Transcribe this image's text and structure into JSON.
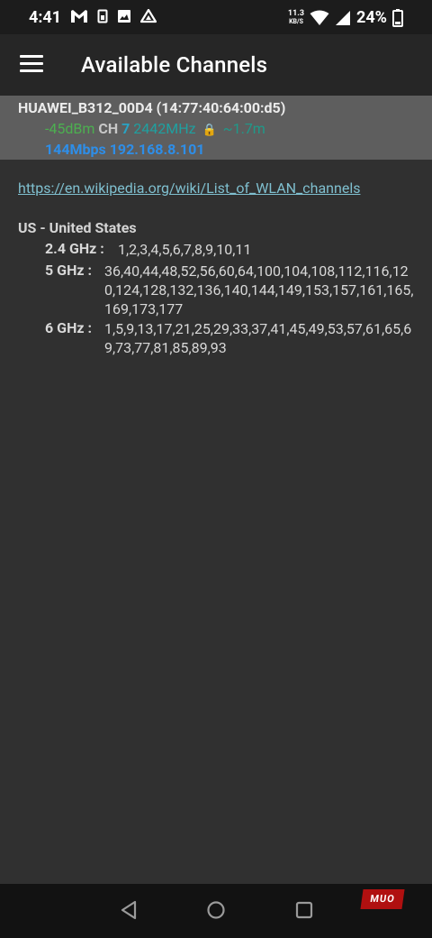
{
  "status_bar": {
    "time": "4:41",
    "left_icons": [
      "gmail-icon",
      "sim-icon",
      "gallery-icon",
      "drive-icon"
    ],
    "speed_value": "11.3",
    "speed_unit": "KB/S",
    "battery": "24%"
  },
  "app_bar": {
    "title": "Available Channels"
  },
  "network": {
    "name": "HUAWEI_B312_00D4 (14:77:40:64:00:d5)",
    "signal": "-45dBm",
    "ch_label": "CH",
    "channel": "7",
    "frequency": "2442MHz",
    "distance": "~1.7m",
    "link_speed": "144Mbps",
    "ip": "192.168.8.101"
  },
  "info": {
    "link": "https://en.wikipedia.org/wiki/List_of_WLAN_channels",
    "country": "US - United States",
    "bands": [
      {
        "label": "2.4 GHz :",
        "channels": "1,2,3,4,5,6,7,8,9,10,11"
      },
      {
        "label": "5 GHz :",
        "channels": "36,40,44,48,52,56,60,64,100,104,108,112,116,120,124,128,132,136,140,144,149,153,157,161,165,169,173,177"
      },
      {
        "label": "6 GHz :",
        "channels": "1,5,9,13,17,21,25,29,33,37,41,45,49,53,57,61,65,69,73,77,81,85,89,93"
      }
    ]
  },
  "nav_bar": {
    "watermark": "MUO"
  },
  "colors": {
    "signal": "#4caf50",
    "channel": "#29a3c4",
    "frequency": "#1fa0a0",
    "speed": "#2e8ee8",
    "link": "#7fbfcf"
  }
}
